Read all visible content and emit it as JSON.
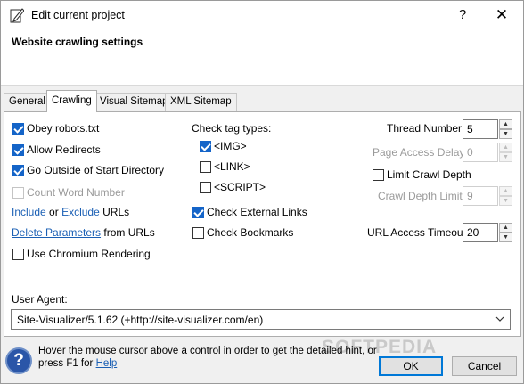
{
  "window": {
    "title": "Edit current project",
    "help_glyph": "?",
    "close_glyph": "✕"
  },
  "header": {
    "title": "Website crawling settings"
  },
  "tabs": [
    {
      "label": "General"
    },
    {
      "label": "Crawling"
    },
    {
      "label": "Visual Sitemap"
    },
    {
      "label": "XML Sitemap"
    }
  ],
  "active_tab": "Crawling",
  "left_options": {
    "obey_robots": {
      "label": "Obey robots.txt",
      "checked": true
    },
    "allow_redirects": {
      "label": "Allow Redirects",
      "checked": true
    },
    "go_outside": {
      "label": "Go Outside of Start Directory",
      "checked": true
    },
    "count_words": {
      "label": "Count Word Number",
      "checked": false,
      "enabled": false
    },
    "include_link": "Include",
    "or_text": "or",
    "exclude_link": "Exclude",
    "urls_text": "URLs",
    "delete_params_link": "Delete Parameters",
    "from_urls_text": "from URLs",
    "chromium": {
      "label": "Use Chromium Rendering",
      "checked": false
    }
  },
  "tag_types": {
    "heading": "Check tag types:",
    "img": {
      "label": "<IMG>",
      "checked": true
    },
    "link": {
      "label": "<LINK>",
      "checked": false
    },
    "script": {
      "label": "<SCRIPT>",
      "checked": false
    },
    "external": {
      "label": "Check External Links",
      "checked": true
    },
    "bookmarks": {
      "label": "Check Bookmarks",
      "checked": false
    }
  },
  "right_options": {
    "thread_number": {
      "label": "Thread Number:",
      "value": "5"
    },
    "page_access_delay": {
      "label": "Page Access Delay:",
      "value": "0",
      "enabled": false
    },
    "limit_crawl_depth": {
      "label": "Limit Crawl Depth",
      "checked": false
    },
    "crawl_depth_limit": {
      "label": "Crawl Depth Limit:",
      "value": "9",
      "enabled": false
    },
    "url_access_timeout": {
      "label": "URL Access Timeout:",
      "value": "20"
    }
  },
  "user_agent": {
    "label": "User Agent:",
    "value": "Site-Visualizer/5.1.62 (+http://site-visualizer.com/en)"
  },
  "footer": {
    "hint_line1": "Hover the mouse cursor above a control in order to get the detailed hint, or",
    "hint_line2_prefix": "press F1 for",
    "help_link": "Help",
    "ok_label": "OK",
    "cancel_label": "Cancel",
    "hint_icon_glyph": "?"
  },
  "watermark": "SOFTPEDIA",
  "colors": {
    "accent": "#1464c8",
    "link": "#1a5fb4",
    "default_button_border": "#0078d7"
  }
}
